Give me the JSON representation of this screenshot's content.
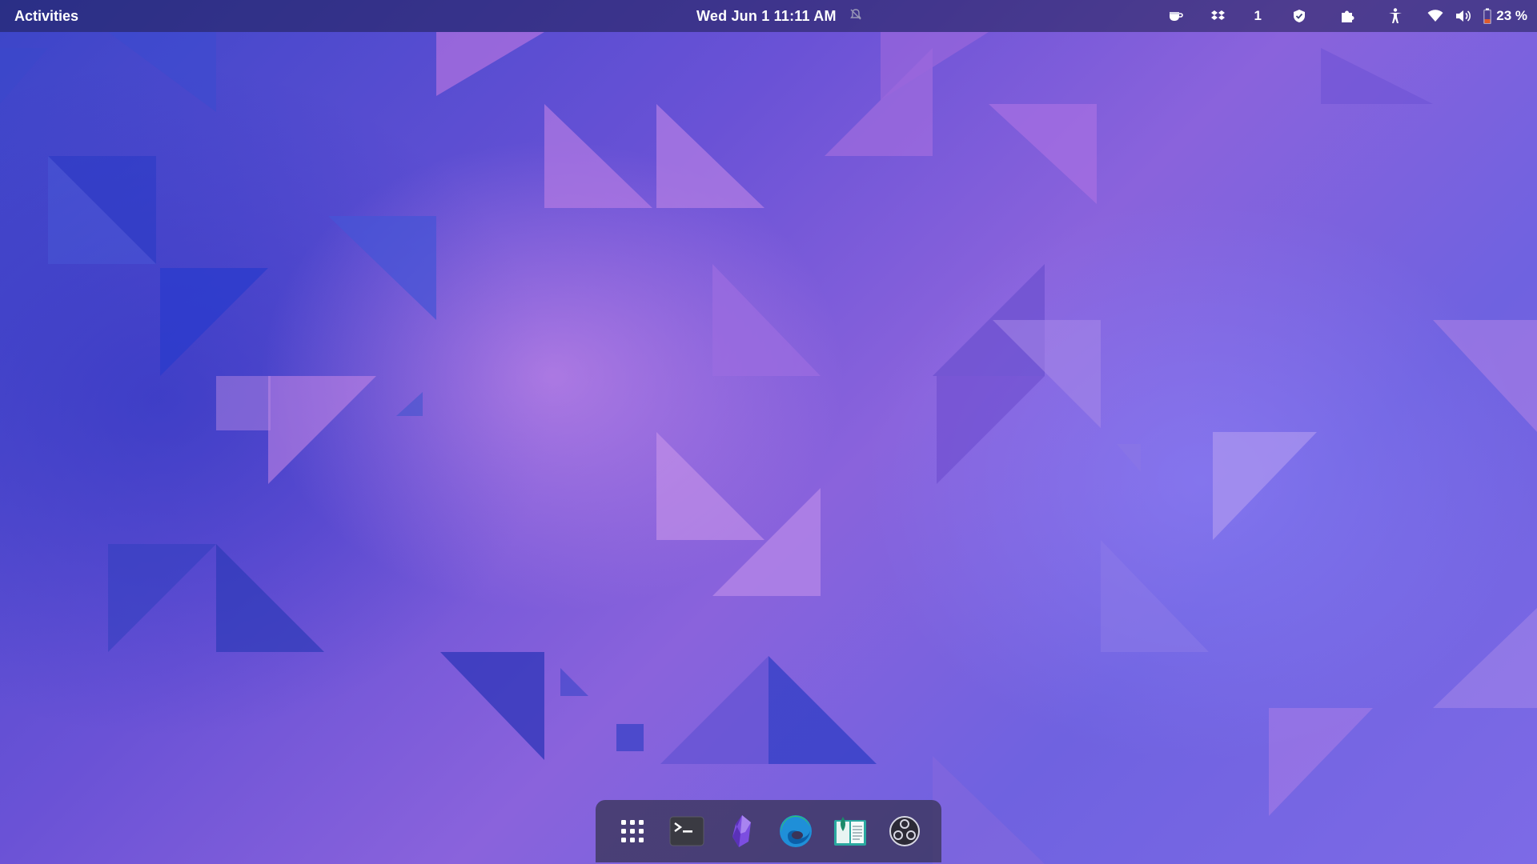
{
  "topbar": {
    "activities_label": "Activities",
    "clock": "Wed Jun 1  11:11 AM",
    "notifications_icon": "bell-muted-icon",
    "tray": {
      "caffeine_icon": "coffee-cup-icon",
      "dropbox_icon": "dropbox-icon",
      "workspace_count": "1",
      "vpn_icon": "shield-icon",
      "extensions_icon": "puzzle-piece-icon",
      "accessibility_icon": "accessibility-icon",
      "wifi_icon": "wifi-icon",
      "volume_icon": "speaker-icon",
      "battery_icon": "battery-low-icon",
      "battery_percent": "23 %",
      "battery_color": "#e05a2b"
    }
  },
  "dock": {
    "items": [
      {
        "name": "show-applications",
        "icon": "app-grid-icon"
      },
      {
        "name": "terminal",
        "icon": "terminal-icon"
      },
      {
        "name": "obsidian",
        "icon": "obsidian-crystal-icon"
      },
      {
        "name": "microsoft-edge",
        "icon": "edge-browser-icon"
      },
      {
        "name": "book-reader",
        "icon": "book-reader-icon"
      },
      {
        "name": "obs-studio",
        "icon": "obs-studio-icon"
      }
    ]
  },
  "colors": {
    "wallpaper_dark": "#3b45c8",
    "wallpaper_mid": "#6a52d6",
    "wallpaper_light": "#d08ee8",
    "panel_bg": "rgba(30,30,80,0.55)",
    "dock_bg": "rgba(58,52,88,0.78)"
  }
}
